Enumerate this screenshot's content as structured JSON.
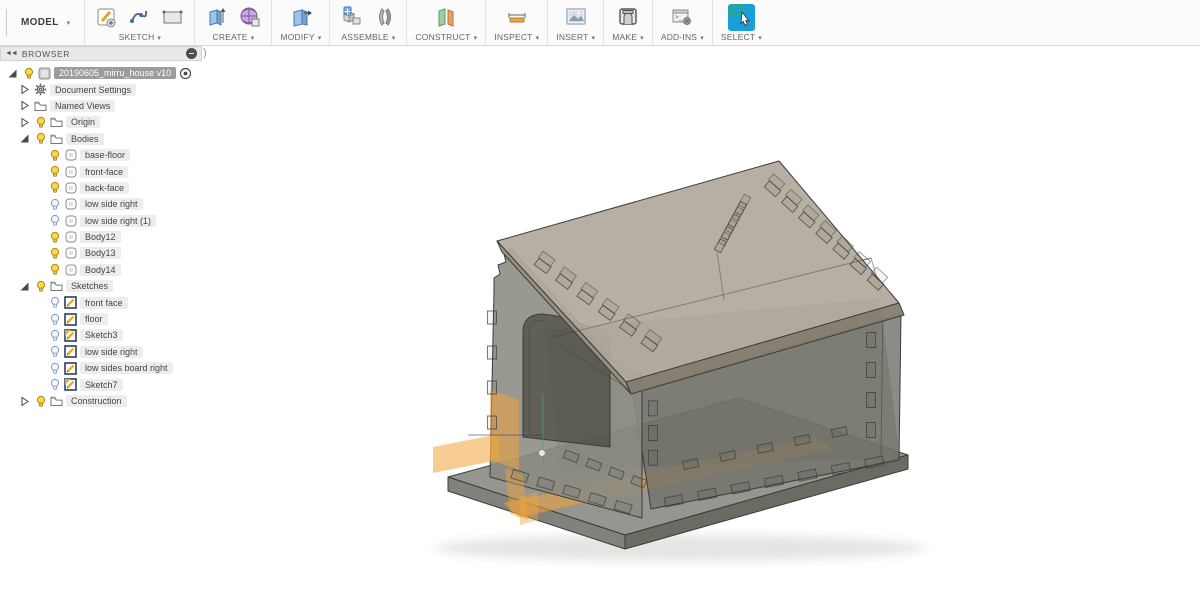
{
  "toolbar": {
    "workspace": "MODEL",
    "groups": [
      {
        "label": "SKETCH",
        "icons": [
          "create-sketch",
          "spline",
          "rectangle"
        ]
      },
      {
        "label": "CREATE",
        "icons": [
          "extrude",
          "form"
        ]
      },
      {
        "label": "MODIFY",
        "icons": [
          "press-pull"
        ]
      },
      {
        "label": "ASSEMBLE",
        "icons": [
          "new-component",
          "joint"
        ]
      },
      {
        "label": "CONSTRUCT",
        "icons": [
          "construction-plane"
        ]
      },
      {
        "label": "INSPECT",
        "icons": [
          "measure"
        ]
      },
      {
        "label": "INSERT",
        "icons": [
          "attached-canvas"
        ]
      },
      {
        "label": "MAKE",
        "icons": [
          "three-d-print"
        ]
      },
      {
        "label": "ADD-INS",
        "icons": [
          "scripts-addins"
        ]
      },
      {
        "label": "SELECT",
        "icons": [
          "select-tool"
        ]
      }
    ]
  },
  "browser": {
    "title": "BROWSER",
    "tree": [
      {
        "label": "20190605_mirru_house v10",
        "level": 0,
        "expander": "open",
        "bulb": "on",
        "icon": "document",
        "selected": true,
        "radio": true
      },
      {
        "label": "Document Settings",
        "level": 1,
        "expander": "closed",
        "bulb": "none",
        "icon": "gear"
      },
      {
        "label": "Named Views",
        "level": 1,
        "expander": "closed",
        "bulb": "none",
        "icon": "folder"
      },
      {
        "label": "Origin",
        "level": 1,
        "expander": "closed",
        "bulb": "on",
        "icon": "folder"
      },
      {
        "label": "Bodies",
        "level": 1,
        "expander": "open",
        "bulb": "on",
        "icon": "folder"
      },
      {
        "label": "base-floor",
        "level": 2,
        "expander": "none",
        "bulb": "on",
        "icon": "body"
      },
      {
        "label": "front-face",
        "level": 2,
        "expander": "none",
        "bulb": "on",
        "icon": "body"
      },
      {
        "label": "back-face",
        "level": 2,
        "expander": "none",
        "bulb": "on",
        "icon": "body"
      },
      {
        "label": "low side right",
        "level": 2,
        "expander": "none",
        "bulb": "off",
        "icon": "body"
      },
      {
        "label": "low side right (1)",
        "level": 2,
        "expander": "none",
        "bulb": "off",
        "icon": "body"
      },
      {
        "label": "Body12",
        "level": 2,
        "expander": "none",
        "bulb": "on",
        "icon": "body"
      },
      {
        "label": "Body13",
        "level": 2,
        "expander": "none",
        "bulb": "on",
        "icon": "body"
      },
      {
        "label": "Body14",
        "level": 2,
        "expander": "none",
        "bulb": "on",
        "icon": "body"
      },
      {
        "label": "Sketches",
        "level": 1,
        "expander": "open",
        "bulb": "on",
        "icon": "folder"
      },
      {
        "label": "front face",
        "level": 2,
        "expander": "none",
        "bulb": "off",
        "icon": "sketch"
      },
      {
        "label": "floor",
        "level": 2,
        "expander": "none",
        "bulb": "off",
        "icon": "sketch"
      },
      {
        "label": "Sketch3",
        "level": 2,
        "expander": "none",
        "bulb": "off",
        "icon": "sketch-modified"
      },
      {
        "label": "low side right",
        "level": 2,
        "expander": "none",
        "bulb": "off",
        "icon": "sketch"
      },
      {
        "label": "low sides board right",
        "level": 2,
        "expander": "none",
        "bulb": "off",
        "icon": "sketch"
      },
      {
        "label": "Sketch7",
        "level": 2,
        "expander": "none",
        "bulb": "off",
        "icon": "sketch-modified"
      },
      {
        "label": "Construction",
        "level": 1,
        "expander": "closed",
        "bulb": "on",
        "icon": "folder"
      }
    ]
  },
  "viewport": {
    "colors": {
      "roof": "#b2a99c",
      "roof_edge": "#988f80",
      "roof_eave": "#857d6f",
      "wall_front": "#8b8b83",
      "wall_side": "#73736b",
      "interior": "#67675f",
      "door_interior": "#57574f",
      "floor_top": "#90908a",
      "floor_left_face": "#7e7e78",
      "floor_right_face": "#66665f",
      "highlight_orange": "#f0a43c",
      "outline": "#3c3c38",
      "green_line": "#49a24b",
      "select_blue": "#189fd7",
      "selected_row_bg": "#9c9c9c"
    }
  }
}
